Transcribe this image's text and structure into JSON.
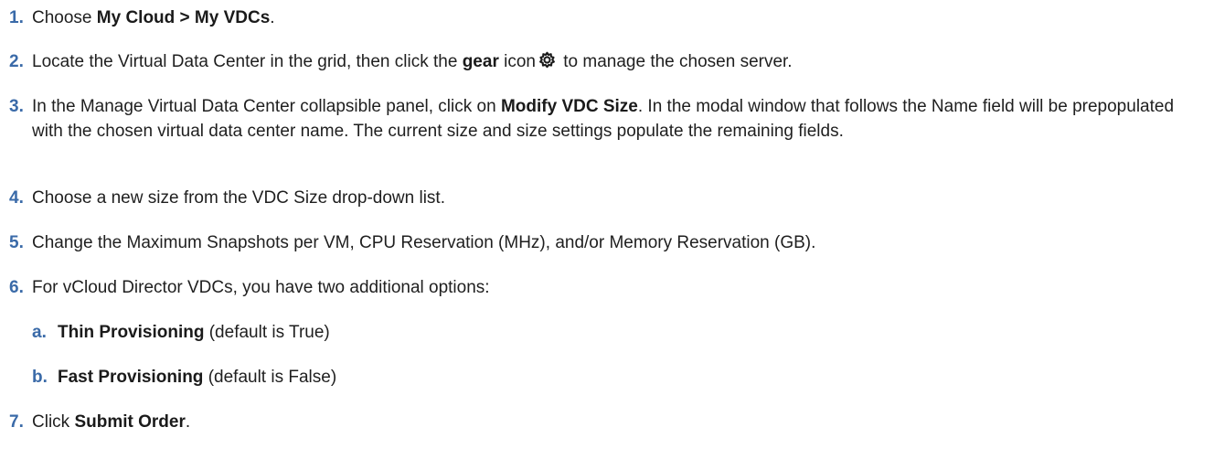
{
  "steps": [
    {
      "number": "1.",
      "pre": "Choose ",
      "bold": "My Cloud > My VDCs",
      "post": "."
    },
    {
      "number": "2.",
      "pre": "Locate the Virtual Data Center in the grid, then click the ",
      "bold": "gear",
      "mid": " icon",
      "icon": "gear-icon",
      "post": " to manage the chosen server."
    },
    {
      "number": "3.",
      "pre": "In the Manage Virtual Data Center collapsible panel, click on ",
      "bold": "Modify VDC Size",
      "post": ". In the modal window that follows the Name field will be prepopulated with the chosen virtual data center name. The current size and size settings populate the remaining fields."
    },
    {
      "number": "4.",
      "text": "Choose a new size from the VDC Size drop-down list."
    },
    {
      "number": "5.",
      "text": "Change the Maximum Snapshots per VM, CPU Reservation (MHz), and/or Memory Reservation (GB)."
    },
    {
      "number": "6.",
      "text": "For vCloud Director VDCs, you have two additional options:",
      "substeps": [
        {
          "letter": "a.",
          "bold": "Thin Provisioning",
          "post": " (default is True)"
        },
        {
          "letter": "b.",
          "bold": "Fast Provisioning",
          "post": " (default is False)"
        }
      ]
    },
    {
      "number": "7.",
      "pre": "Click ",
      "bold": "Submit Order",
      "post": "."
    }
  ]
}
